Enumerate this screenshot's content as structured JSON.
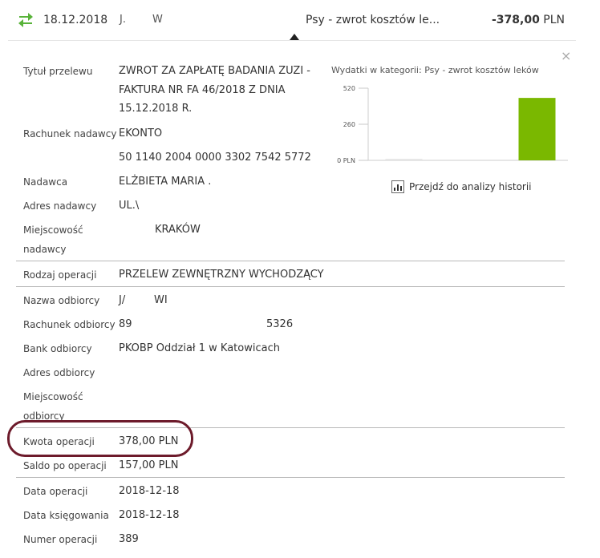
{
  "header": {
    "date": "18.12.2018",
    "name_part1": "J.",
    "name_part2": "W",
    "category": "Psy - zwrot kosztów le...",
    "amount_value": "-378,00",
    "amount_currency": "PLN"
  },
  "details": {
    "tytul_label": "Tytuł przelewu",
    "tytul_line1": "ZWROT ZA ZAPŁATĘ BADANIA ZUZI -",
    "tytul_line2": "FAKTURA NR FA 46/2018 Z DNIA",
    "tytul_line3": "15.12.2018 R.",
    "rach_nad_label": "Rachunek nadawcy",
    "rach_nad_line1": "EKONTO",
    "rach_nad_line2": "50 1140 2004 0000 3302 7542 5772",
    "nadawca_label": "Nadawca",
    "nadawca_value": "ELŻBIETA MARIA .",
    "adres_nad_label": "Adres nadawcy",
    "adres_nad_value": "UL.\\",
    "miejsc_nad_label1": "Miejscowość",
    "miejsc_nad_label2": "nadawcy",
    "miejsc_nad_value": "KRAKÓW",
    "rodzaj_label": "Rodzaj operacji",
    "rodzaj_value": "PRZELEW ZEWNĘTRZNY WYCHODZĄCY",
    "nazwa_odb_label": "Nazwa odbiorcy",
    "nazwa_odb_value1": "J/",
    "nazwa_odb_value2": "WI",
    "rach_odb_label": "Rachunek odbiorcy",
    "rach_odb_value1": "89",
    "rach_odb_value2": "5326",
    "bank_odb_label": "Bank odbiorcy",
    "bank_odb_value": "PKOBP Oddział 1 w Katowicach",
    "adres_odb_label": "Adres odbiorcy",
    "miejsc_odb_label1": "Miejscowość",
    "miejsc_odb_label2": "odbiorcy",
    "kwota_label": "Kwota operacji",
    "kwota_value": "378,00 PLN",
    "saldo_label": "Saldo po operacji",
    "saldo_value": "157,00 PLN",
    "data_op_label": "Data operacji",
    "data_op_value": "2018-12-18",
    "data_ks_label": "Data księgowania",
    "data_ks_value": "2018-12-18",
    "numer_label": "Numer operacji",
    "numer_value": "389"
  },
  "chart_data": {
    "type": "bar",
    "title": "Wydatki w kategorii:  Psy - zwrot kosztów leków",
    "categories": [
      "",
      "",
      ""
    ],
    "values": [
      10,
      0,
      450
    ],
    "colors": [
      "#e3e3e3",
      "#e3e3e3",
      "#7ab800"
    ],
    "yticks": [
      "520",
      "260",
      "0 PLN"
    ],
    "ylim": [
      0,
      520
    ]
  },
  "analysis_link": "Przejdź do analizy historii",
  "colors": {
    "accent_green": "#7ab800",
    "highlight_ring": "#6d1b2b",
    "divider": "#b9b9b9"
  }
}
